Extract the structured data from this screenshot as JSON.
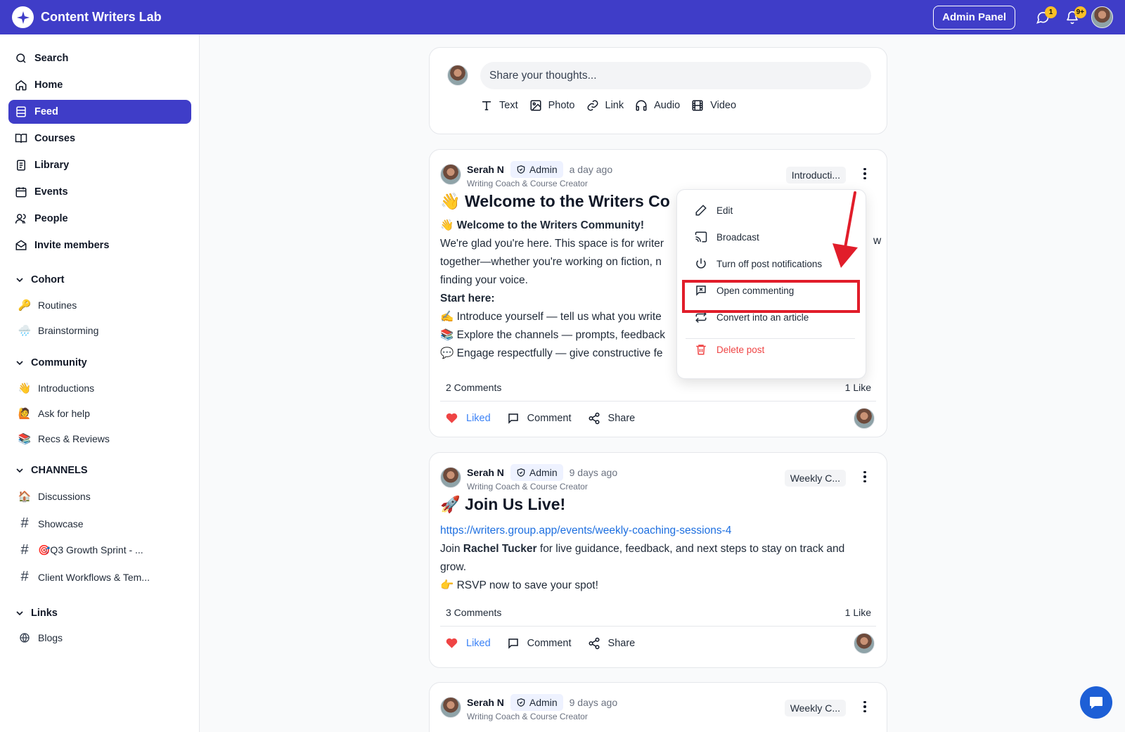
{
  "app": {
    "title": "Content Writers Lab"
  },
  "topbar": {
    "admin_panel": "Admin Panel",
    "chat_badge": "1",
    "notif_badge": "9+"
  },
  "sidebar": {
    "nav": [
      "Search",
      "Home",
      "Feed",
      "Courses",
      "Library",
      "Events",
      "People",
      "Invite members"
    ],
    "sections": [
      {
        "title": "Cohort",
        "items": [
          {
            "icon": "🔑",
            "label": "Routines"
          },
          {
            "icon": "🌧️",
            "label": "Brainstorming"
          }
        ]
      },
      {
        "title": "Community",
        "items": [
          {
            "icon": "👋",
            "label": "Introductions"
          },
          {
            "icon": "🙋",
            "label": "Ask for help"
          },
          {
            "icon": "📚",
            "label": "Recs & Reviews"
          }
        ]
      },
      {
        "title": "CHANNELS",
        "items": [
          {
            "icon": "🏠",
            "label": "Discussions"
          },
          {
            "icon": "#",
            "label": "Showcase"
          },
          {
            "icon": "#",
            "label": "🎯Q3 Growth Sprint - ..."
          },
          {
            "icon": "#",
            "label": "Client Workflows & Tem..."
          }
        ]
      },
      {
        "title": "Links",
        "items": [
          {
            "icon": "globe",
            "label": "Blogs"
          }
        ]
      }
    ]
  },
  "composer": {
    "placeholder": "Share your thoughts...",
    "tools": [
      "Text",
      "Photo",
      "Link",
      "Audio",
      "Video"
    ]
  },
  "posts": [
    {
      "author": "Serah N",
      "badge": "Admin",
      "time": "a day ago",
      "role": "Writing Coach & Course Creator",
      "channel": "Introducti...",
      "title": "👋  Welcome to the Writers Co",
      "lines": [
        "👋  Welcome to the Writers Community!",
        "We're glad you're here. This space is for writer",
        "together—whether you're working on fiction, n",
        "finding your voice.",
        "Start here:",
        "✍️  Introduce yourself — tell us what you write",
        "📚  Explore the channels — prompts, feedback",
        "💬  Engage respectfully — give constructive fe"
      ],
      "overflow_char": "w",
      "comments": "2 Comments",
      "likes": "1 Like",
      "actions": {
        "liked": "Liked",
        "comment": "Comment",
        "share": "Share"
      }
    },
    {
      "author": "Serah N",
      "badge": "Admin",
      "time": "9 days ago",
      "role": "Writing Coach & Course Creator",
      "channel": "Weekly C...",
      "title": "🚀  Join Us Live!",
      "link": "https://writers.group.app/events/weekly-coaching-sessions-4",
      "join_pre": "Join ",
      "join_name": "Rachel Tucker",
      "join_post": " for live guidance, feedback, and next steps to stay on track and",
      "join_line2": "grow.",
      "rsvp": "👉  RSVP now to save your spot!",
      "comments": "3 Comments",
      "likes": "1 Like",
      "actions": {
        "liked": "Liked",
        "comment": "Comment",
        "share": "Share"
      }
    },
    {
      "author": "Serah N",
      "badge": "Admin",
      "time": "9 days ago",
      "role": "Writing Coach & Course Creator",
      "channel": "Weekly C..."
    }
  ],
  "menu": {
    "items": [
      "Edit",
      "Broadcast",
      "Turn off post notifications",
      "Open commenting",
      "Convert into an article"
    ],
    "delete": "Delete post"
  },
  "colors": {
    "brand": "#3f3dc8",
    "annotation": "#e11d2a",
    "like": "#ef4444"
  }
}
